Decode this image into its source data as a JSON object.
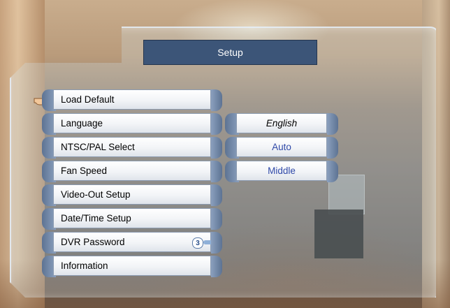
{
  "title": "Setup",
  "menu": {
    "items": [
      {
        "label": "Load Default"
      },
      {
        "label": "Language"
      },
      {
        "label": "NTSC/PAL Select"
      },
      {
        "label": "Fan Speed"
      },
      {
        "label": "Video-Out Setup"
      },
      {
        "label": "Date/Time Setup"
      },
      {
        "label": "DVR Password",
        "badge": "3"
      },
      {
        "label": "Information"
      }
    ]
  },
  "values": {
    "language": "English",
    "ntsc_pal": "Auto",
    "fan_speed": "Middle"
  },
  "icons": {
    "pointer": "pointing-hand-icon",
    "password_key": "key-icon"
  },
  "colors": {
    "title_bar": "#3c5578",
    "value_text": "#2f49a8"
  }
}
